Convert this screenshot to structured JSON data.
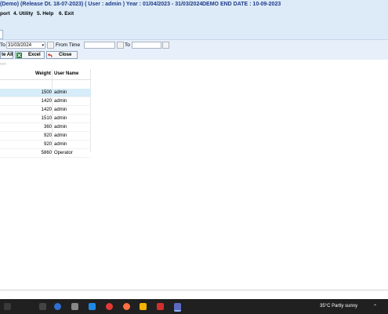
{
  "window": {
    "title": "(Demo) (Release Dt. 18-07-2023)  ( User : admin ) Year : 01/04/2023 - 31/03/2024",
    "demo_end": "DEMO END DATE : 10-09-2023"
  },
  "menu": {
    "items": [
      {
        "label": "port"
      },
      {
        "label": "4. Utility"
      },
      {
        "label": "5. Help"
      },
      {
        "label": "6. Exit"
      }
    ]
  },
  "toolbar": {
    "to_label": "To",
    "to_date": "31/03/2024",
    "from_time_label": "From Time",
    "from_time": "",
    "to_time_label": "To",
    "to_time": "",
    "buttons": [
      {
        "label": "te All"
      },
      {
        "label": "Excel"
      },
      {
        "label": "Close"
      }
    ]
  },
  "filter": {
    "hint": "ren"
  },
  "table": {
    "headers": {
      "weight": "Weight",
      "user": "User Name"
    },
    "rows": [
      {
        "weight": "1500",
        "user": "admin",
        "selected": true
      },
      {
        "weight": "1420",
        "user": "admin"
      },
      {
        "weight": "1420",
        "user": "admin"
      },
      {
        "weight": "1510",
        "user": "admin"
      },
      {
        "weight": "360",
        "user": "admin"
      },
      {
        "weight": "920",
        "user": "admin"
      },
      {
        "weight": "920",
        "user": "admin"
      },
      {
        "weight": "5860",
        "user": "Operator"
      }
    ]
  },
  "taskbar": {
    "weather": "35°C  Partly sunny",
    "icons": [
      "windows-start-icon",
      "search-icon",
      "taskview-icon",
      "edge-icon",
      "store-icon",
      "chrome-icon",
      "firefox-icon",
      "file-explorer-icon",
      "wps-icon",
      "app-icon"
    ],
    "colors": {
      "bg": "#202020"
    }
  },
  "colors": {
    "title_bg": "#dcebf7",
    "title_text": "#1f3a8a",
    "selected_row": "#d6ecf8"
  }
}
